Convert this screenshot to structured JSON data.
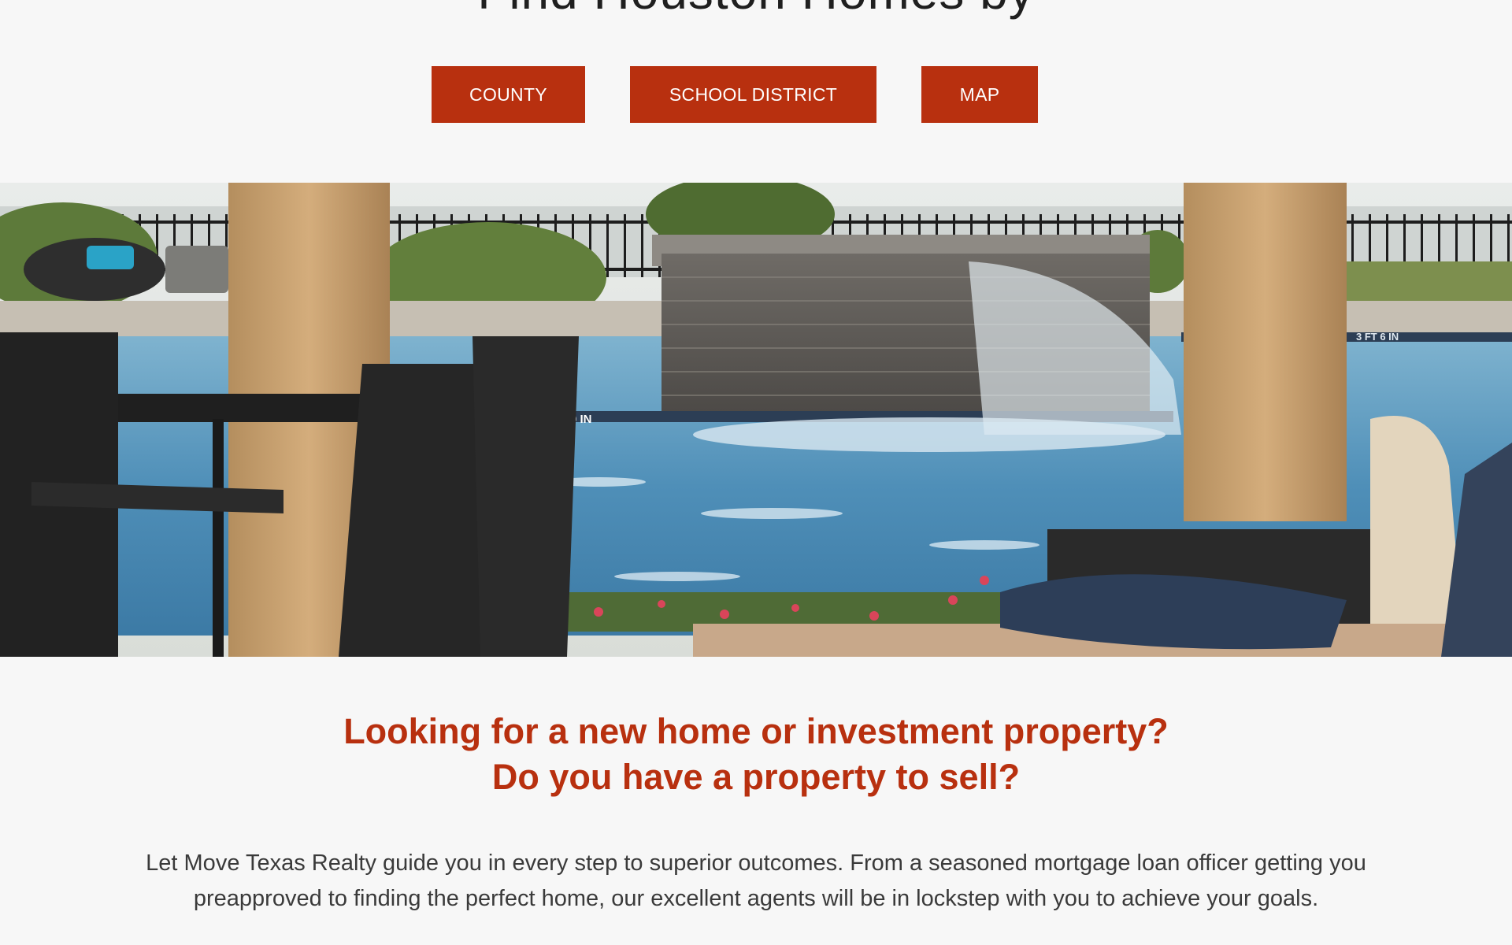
{
  "page": {
    "top_heading": "Find Houston Homes by"
  },
  "search_buttons": [
    {
      "label": "COUNTY"
    },
    {
      "label": "SCHOOL DISTRICT"
    },
    {
      "label": "MAP"
    }
  ],
  "hero_image": {
    "description": "pool-patio-photo",
    "pool_depth_marker_left": "0 IN",
    "pool_depth_marker_right": "3 FT 6 IN"
  },
  "intro": {
    "headline_line1": "Looking for a new home or investment property?",
    "headline_line2": "Do you have a property to sell?",
    "body": "Let Move Texas Realty guide you in every step to superior outcomes. From a seasoned mortgage loan officer getting you preapproved to finding the perfect home, our excellent agents will be in lockstep with you to achieve your goals."
  },
  "colors": {
    "accent": "#b8300f",
    "background": "#f7f7f7",
    "text": "#3a3a3a"
  }
}
